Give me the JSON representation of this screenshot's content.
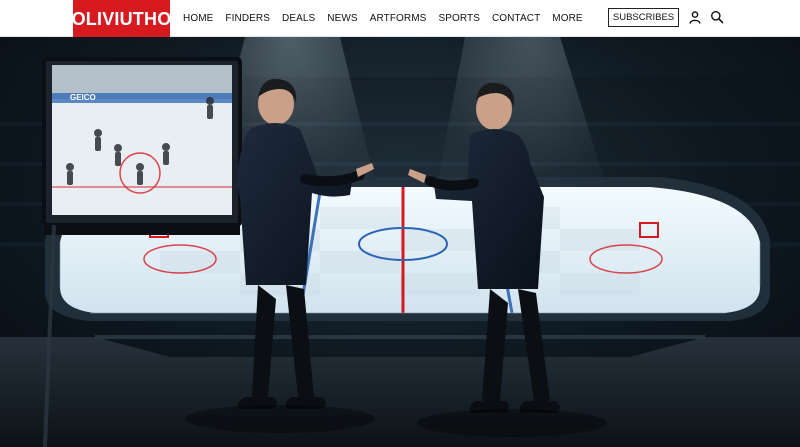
{
  "header": {
    "logo_text": "OLIVIUTHO",
    "nav": [
      "HOME",
      "FINDERS",
      "DEALS",
      "NEWS",
      "ARTFORMS",
      "SPORTS",
      "CONTACT",
      "MORE"
    ],
    "subscribe_label": "SUBSCRIBES",
    "icons": [
      "user-icon",
      "search-icon"
    ]
  },
  "hero": {
    "screen_sponsor": "GEICO",
    "accent": "#d71920",
    "ice_color": "#dfeaf2"
  }
}
